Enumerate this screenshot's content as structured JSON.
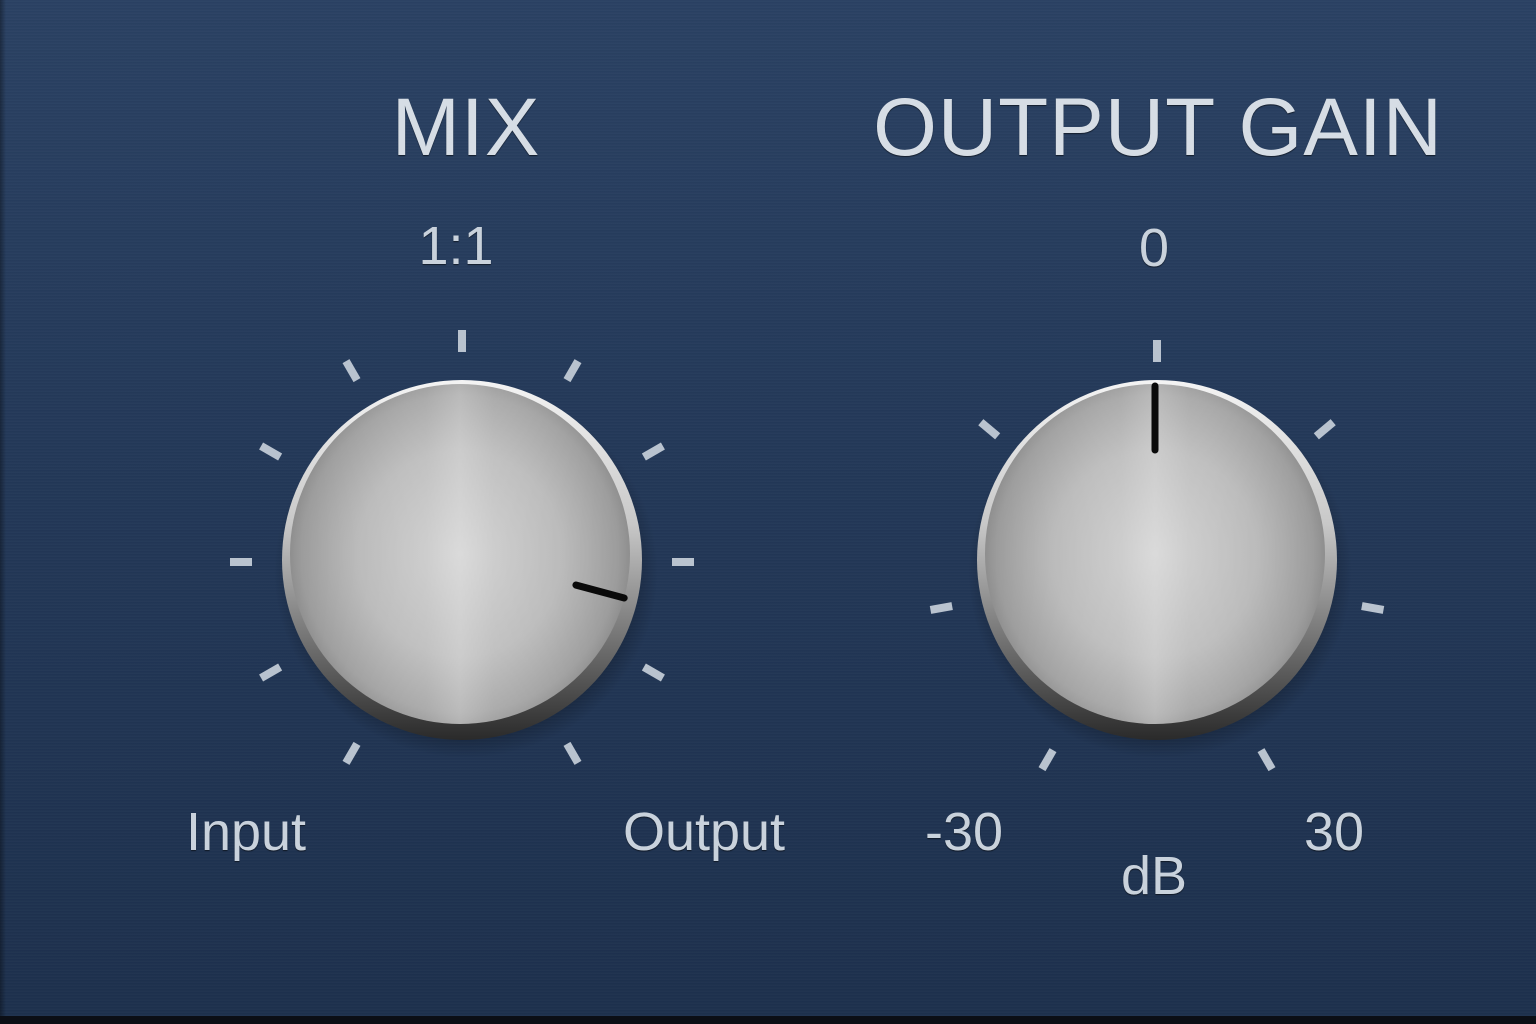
{
  "mix": {
    "title": "MIX",
    "center_label": "1:1",
    "min_label": "Input",
    "max_label": "Output",
    "value_fraction": 0.85
  },
  "output_gain": {
    "title": "OUTPUT GAIN",
    "center_label": "0",
    "min_label": "-30",
    "max_label": "30",
    "unit_label": "dB",
    "value_db": 0
  },
  "colors": {
    "panel": "#233858",
    "label": "#c9d2dc",
    "tick": "#b9c3cf",
    "knob_pointer": "#0a0a0a"
  },
  "icons": {
    "mix_knob": "brushed-metal-knob",
    "gain_knob": "brushed-metal-knob"
  }
}
